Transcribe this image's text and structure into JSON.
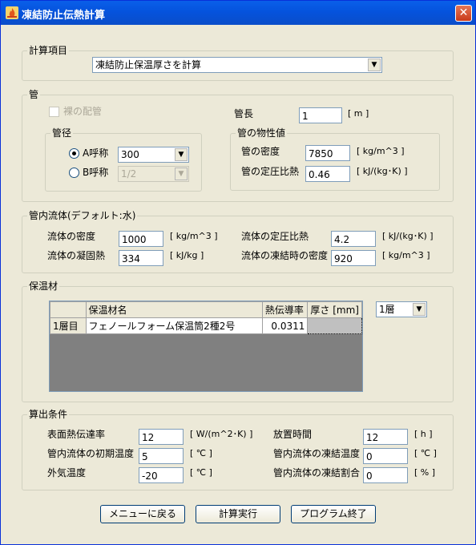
{
  "window": {
    "title": "凍結防止伝熱計算",
    "close_symbol": "✕"
  },
  "calc_item": {
    "legend": "計算項目",
    "selected": "凍結防止保温厚さを計算"
  },
  "pipe": {
    "legend": "管",
    "bare_pipe_label": "裸の配管",
    "length_label": "管長",
    "length_value": "1",
    "length_unit": "[ m ]",
    "diameter": {
      "legend": "管径",
      "a_label": "A呼称",
      "a_value": "300",
      "b_label": "B呼称",
      "b_value": "1/2"
    },
    "props": {
      "legend": "管の物性値",
      "density_label": "管の密度",
      "density_value": "7850",
      "density_unit": "[ kg/m^3 ]",
      "cp_label": "管の定圧比熱",
      "cp_value": "0.46",
      "cp_unit": "[ kJ/(kg･K) ]"
    }
  },
  "fluid": {
    "legend": "管内流体(デフォルト:水)",
    "density_label": "流体の密度",
    "density_value": "1000",
    "density_unit": "[ kg/m^3 ]",
    "cp_label": "流体の定圧比熱",
    "cp_value": "4.2",
    "cp_unit": "[ kJ/(kg･K) ]",
    "latent_label": "流体の凝固熱",
    "latent_value": "334",
    "latent_unit": "[ kJ/kg ]",
    "frozen_density_label": "流体の凍結時の密度",
    "frozen_density_value": "920",
    "frozen_density_unit": "[ kg/m^3 ]"
  },
  "insulation": {
    "legend": "保温材",
    "columns": [
      "",
      "保温材名",
      "熱伝導率",
      "厚さ [mm]"
    ],
    "rows": [
      {
        "layer": "1層目",
        "name": "フェノールフォーム保温筒2種2号",
        "conductivity": "0.0311",
        "thickness": ""
      }
    ],
    "layers_selected": "1層"
  },
  "conditions": {
    "legend": "算出条件",
    "htc_label": "表面熱伝達率",
    "htc_value": "12",
    "htc_unit": "[ W/(m^2･K) ]",
    "time_label": "放置時間",
    "time_value": "12",
    "time_unit": "[ h ]",
    "init_temp_label": "管内流体の初期温度",
    "init_temp_value": "5",
    "init_temp_unit": "[ ℃ ]",
    "freeze_temp_label": "管内流体の凍結温度",
    "freeze_temp_value": "0",
    "freeze_temp_unit": "[ ℃ ]",
    "ambient_label": "外気温度",
    "ambient_value": "-20",
    "ambient_unit": "[ ℃ ]",
    "freeze_ratio_label": "管内流体の凍結割合",
    "freeze_ratio_value": "0",
    "freeze_ratio_unit": "[ % ]"
  },
  "buttons": {
    "back": "メニューに戻る",
    "run": "計算実行",
    "exit": "プログラム終了"
  },
  "colors": {
    "titlebar": "#0553dd",
    "face": "#ece9d8",
    "grid_empty": "#808080",
    "selected_cell": "#c0c0c0"
  }
}
